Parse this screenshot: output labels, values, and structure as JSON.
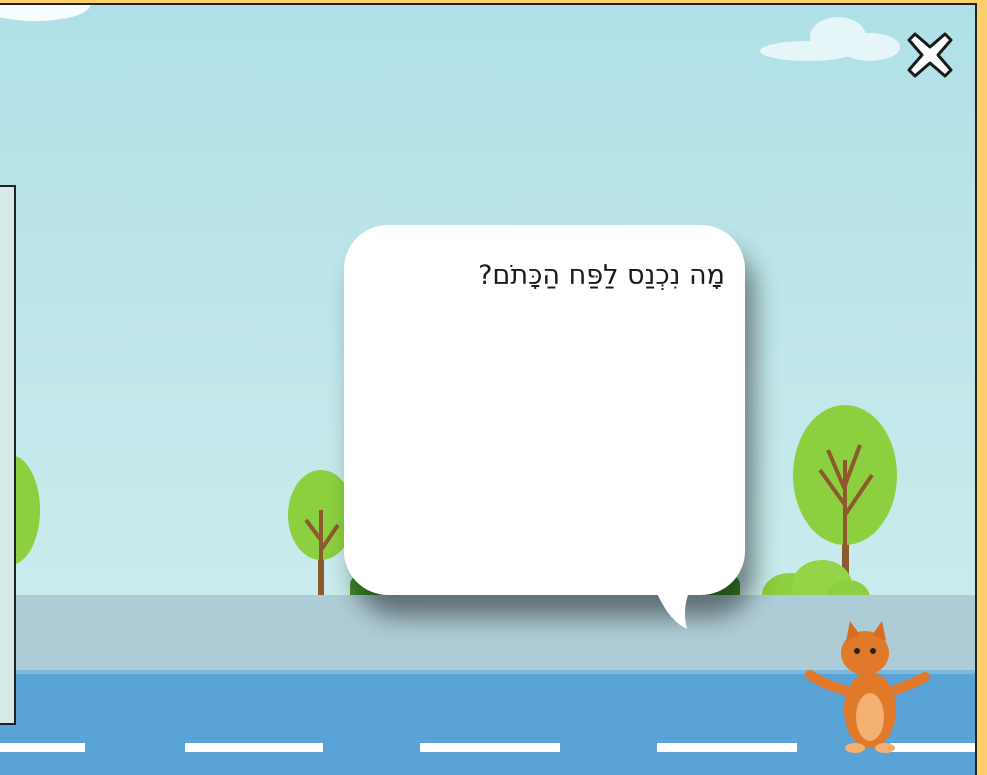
{
  "game": {
    "question": "מָה נִכְנַס לַפַּח הַכָּתֹם?",
    "close_icon": "close-x-icon",
    "character": "orange-cat"
  },
  "colors": {
    "border": "#f9c85a",
    "sky": "#b0e0e7",
    "road": "#5aa3d6",
    "bubble": "#ffffff"
  }
}
